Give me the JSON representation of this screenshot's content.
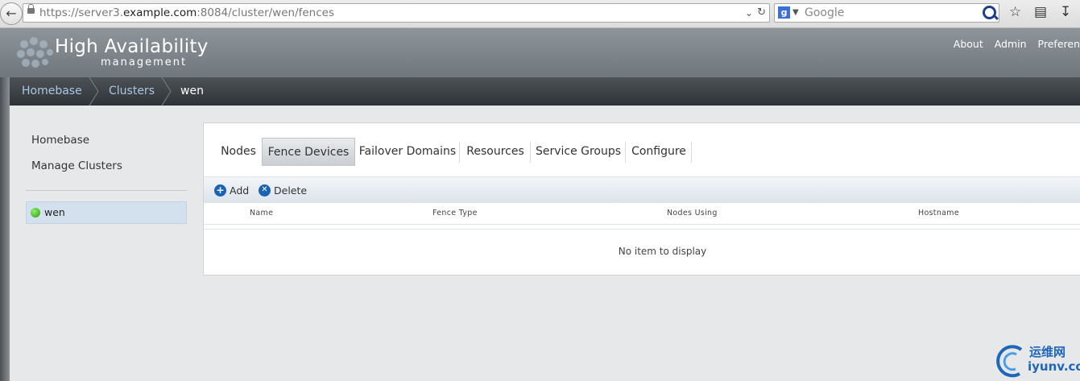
{
  "browser": {
    "url_prefix": "https://server3.",
    "url_host": "example.com",
    "url_suffix": ":8084/cluster/wen/fences",
    "search_placeholder": "Google"
  },
  "header": {
    "title": "High Availability",
    "subtitle": "management",
    "nav": [
      "About",
      "Admin",
      "Preferen"
    ]
  },
  "breadcrumb": [
    "Homebase",
    "Clusters",
    "wen"
  ],
  "sidebar": {
    "links": [
      "Homebase",
      "Manage Clusters"
    ],
    "clusters": [
      {
        "name": "wen",
        "status": "online",
        "status_color": "#3fbf1f"
      }
    ]
  },
  "tabs": [
    {
      "label": "Nodes",
      "active": false
    },
    {
      "label": "Fence Devices",
      "active": true
    },
    {
      "label": "Failover Domains",
      "active": false
    },
    {
      "label": "Resources",
      "active": false
    },
    {
      "label": "Service Groups",
      "active": false
    },
    {
      "label": "Configure",
      "active": false
    }
  ],
  "toolbar": {
    "add_label": "Add",
    "delete_label": "Delete"
  },
  "table": {
    "columns": [
      "Name",
      "Fence Type",
      "Nodes Using",
      "Hostname"
    ],
    "empty_message": "No item to display"
  },
  "watermark": {
    "line1": "运维网",
    "line2": "iyunv.com"
  },
  "colors": {
    "accent": "#1a63b3",
    "link": "#a9c6e4"
  }
}
